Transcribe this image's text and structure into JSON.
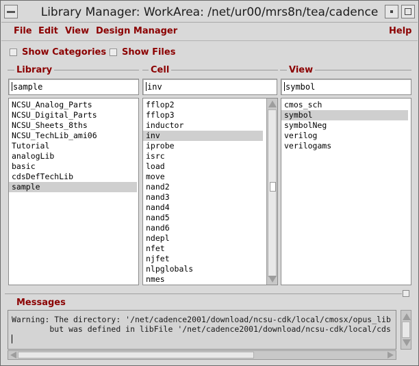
{
  "window": {
    "title": "Library Manager: WorkArea: /net/ur00/mrs8n/tea/cadence"
  },
  "menu": {
    "file": "File",
    "edit": "Edit",
    "view": "View",
    "design_manager": "Design Manager",
    "help": "Help"
  },
  "options": {
    "show_categories": "Show Categories",
    "show_files": "Show Files"
  },
  "library": {
    "label": "Library",
    "value": "sample",
    "items": [
      {
        "label": "NCSU_Analog_Parts"
      },
      {
        "label": "NCSU_Digital_Parts"
      },
      {
        "label": "NCSU_Sheets_8ths"
      },
      {
        "label": "NCSU_TechLib_ami06"
      },
      {
        "label": "Tutorial"
      },
      {
        "label": "analogLib"
      },
      {
        "label": "basic"
      },
      {
        "label": "cdsDefTechLib"
      },
      {
        "label": "sample"
      }
    ],
    "selected": "sample"
  },
  "cell": {
    "label": "Cell",
    "value": "inv",
    "items": [
      {
        "label": "fflop2"
      },
      {
        "label": "fflop3"
      },
      {
        "label": "inductor"
      },
      {
        "label": "inv"
      },
      {
        "label": "iprobe"
      },
      {
        "label": "isrc"
      },
      {
        "label": "load"
      },
      {
        "label": "move"
      },
      {
        "label": "nand2"
      },
      {
        "label": "nand3"
      },
      {
        "label": "nand4"
      },
      {
        "label": "nand5"
      },
      {
        "label": "nand6"
      },
      {
        "label": "ndepl"
      },
      {
        "label": "nfet"
      },
      {
        "label": "njfet"
      },
      {
        "label": "nlpglobals"
      },
      {
        "label": "nmes"
      }
    ],
    "selected": "inv"
  },
  "view": {
    "label": "View",
    "value": "symbol",
    "items": [
      {
        "label": "cmos_sch"
      },
      {
        "label": "symbol"
      },
      {
        "label": "symbolNeg"
      },
      {
        "label": "verilog"
      },
      {
        "label": "verilogams"
      }
    ],
    "selected": "symbol"
  },
  "messages": {
    "label": "Messages",
    "lines": [
      "Warning: The directory: '/net/cadence2001/download/ncsu-cdk/local/cmosx/opus_lib",
      "        but was defined in libFile '/net/cadence2001/download/ncsu-cdk/local/cds"
    ]
  }
}
